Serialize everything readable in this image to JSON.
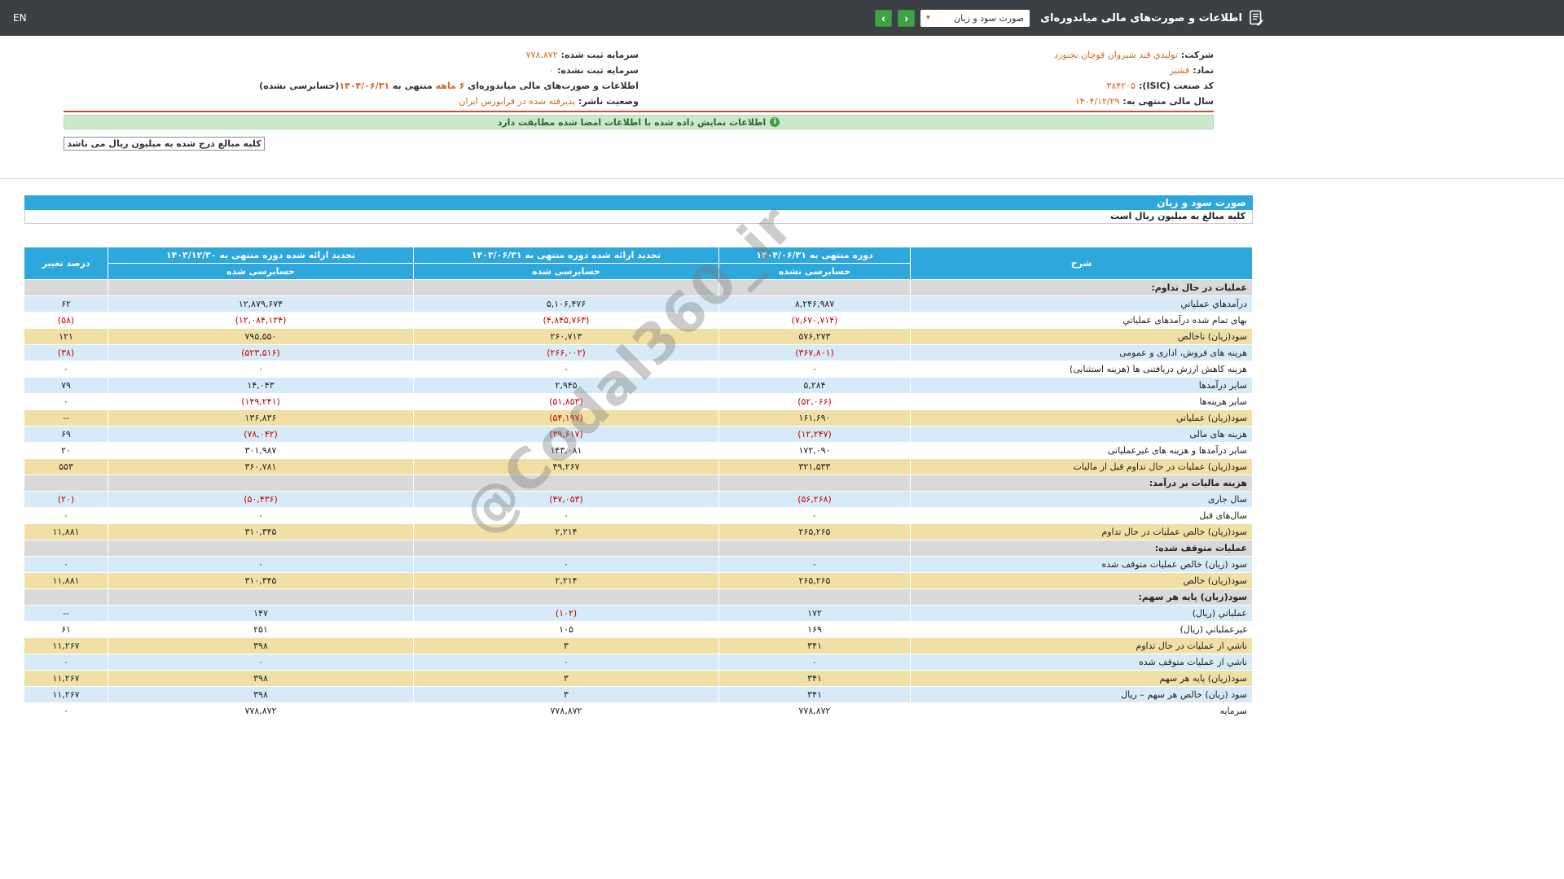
{
  "navbar": {
    "report_title": "اطلاعات و صورت‌های مالی میاندوره‌ای",
    "statement_select": "صورت سود و زیان",
    "caret_glyph": "▾",
    "prev_glyph": "‹",
    "next_glyph": "›",
    "lang": "EN"
  },
  "company": {
    "rows_right": [
      {
        "label": "شرکت:",
        "value": "تولیدي قند شیروان قوچان بجنورد"
      },
      {
        "label": "نماد:",
        "value": "قشیر"
      },
      {
        "label": "کد صنعت (ISIC):",
        "value": "۳۸۴۲۰۵"
      },
      {
        "label": "سال مالی منتهی به:",
        "value": "۱۴۰۴/۱۲/۲۹"
      }
    ],
    "rows_left": [
      {
        "label": "سرمایه ثبت شده:",
        "value": "۷۷۸,۸۷۲"
      },
      {
        "label": "سرمایه ثبت نشده:",
        "value": "۰"
      },
      {
        "parts": [
          {
            "text": "اطلاعات و صورت‌های مالی میاندوره‌ای ",
            "hl": false
          },
          {
            "text": "۶ ماهه",
            "hl": true
          },
          {
            "text": " منتهی به ",
            "hl": false
          },
          {
            "text": "۱۴۰۴/۰۶/۳۱",
            "hl": true
          },
          {
            "text": "(حسابرسی نشده)",
            "hl": false
          }
        ]
      },
      {
        "label": "وضعیت ناشر:",
        "value": "پذیرفته شده در فرابورس ایران"
      }
    ]
  },
  "signed_notice": {
    "icon_glyph": "i",
    "text": "اطلاعات نمایش داده شده با اطلاعات امضا شده مطابقت دارد"
  },
  "unit_note": "کلیه مبالغ درج شده به میلیون ریال می باشد",
  "statement": {
    "title": "صورت سود و زیان",
    "subtitle": "کلیه مبالغ به میلیون ریال است"
  },
  "watermark": "@Codal360_ir",
  "colors": {
    "navbar_bg": "#3b4045",
    "accent_blue": "#2ea7dc",
    "row_blue": "#d6ebf7",
    "row_gold": "#f1e0a6",
    "section_gray": "#d9d9d9",
    "negative_red": "#cc0000",
    "highlight_orange": "#d2691e",
    "button_green": "#43a047",
    "banner_green_bg": "#cce8cc",
    "info_rule_red": "#c05046"
  },
  "table": {
    "headers": {
      "desc": "شرح",
      "cols": [
        {
          "title": "دوره منتهی به ۱۴۰۴/۰۶/۳۱",
          "sub": "حسابرسی نشده"
        },
        {
          "title": "تجدید ارائه شده دوره منتهی به ۱۴۰۳/۰۶/۳۱",
          "sub": "حسابرسی شده"
        },
        {
          "title": "تجدید ارائه شده دوره منتهی به ۱۴۰۳/۱۲/۳۰",
          "sub": "حسابرسی شده"
        }
      ],
      "change": "درصد تغییر"
    },
    "rows": [
      {
        "t": "section",
        "label": "عملیات در حال تداوم:"
      },
      {
        "t": "row",
        "v": "blue",
        "label": "درآمدهاي عملیاتي",
        "c": [
          "۸,۲۴۶,۹۸۷",
          "۵,۱۰۶,۴۷۶",
          "۱۲,۸۷۹,۶۷۴",
          "۶۲"
        ]
      },
      {
        "t": "row",
        "v": "white",
        "label": "بهای تمام شده درآمدهای عملیاتي",
        "c": [
          "(۷,۶۷۰,۷۱۴)",
          "(۴,۸۴۵,۷۶۳)",
          "(۱۲,۰۸۴,۱۲۴)",
          "(۵۸)"
        ]
      },
      {
        "t": "row",
        "v": "gold",
        "label": "سود(زیان) ناخالص",
        "c": [
          "۵۷۶,۲۷۳",
          "۲۶۰,۷۱۳",
          "۷۹۵,۵۵۰",
          "۱۲۱"
        ]
      },
      {
        "t": "row",
        "v": "blue",
        "label": "هزینه های فروش، اداری و عمومی",
        "c": [
          "(۳۶۷,۸۰۱)",
          "(۲۶۶,۰۰۲)",
          "(۵۲۳,۵۱۶)",
          "(۳۸)"
        ]
      },
      {
        "t": "row",
        "v": "white",
        "label": "هزینه کاهش ارزش دریافتنی ها (هزینه استثنایی)",
        "c": [
          "۰",
          "۰",
          "۰",
          "۰"
        ]
      },
      {
        "t": "row",
        "v": "blue",
        "label": "سایر درآمدها",
        "c": [
          "۵,۲۸۴",
          "۲,۹۴۵",
          "۱۴,۰۴۳",
          "۷۹"
        ]
      },
      {
        "t": "row",
        "v": "white",
        "label": "سایر هزینه‌ها",
        "c": [
          "(۵۲,۰۶۶)",
          "(۵۱,۸۵۳)",
          "(۱۴۹,۲۴۱)",
          "۰"
        ]
      },
      {
        "t": "row",
        "v": "gold",
        "label": "سود(زیان) عملیاتي",
        "c": [
          "۱۶۱,۶۹۰",
          "(۵۴,۱۹۷)",
          "۱۳۶,۸۳۶",
          "--"
        ]
      },
      {
        "t": "row",
        "v": "blue",
        "label": "هزینه های مالی",
        "c": [
          "(۱۲,۲۴۷)",
          "(۳۹,۶۱۷)",
          "(۷۸,۰۴۲)",
          "۶۹"
        ]
      },
      {
        "t": "row",
        "v": "white",
        "label": "سایر درآمدها و هزینه های غیرعملیاتی",
        "c": [
          "۱۷۲,۰۹۰",
          "۱۴۳,۰۸۱",
          "۳۰۱,۹۸۷",
          "۲۰"
        ]
      },
      {
        "t": "row",
        "v": "gold",
        "label": "سود(زیان) عملیات در حال تداوم قبل از مالیات",
        "c": [
          "۳۲۱,۵۳۳",
          "۴۹,۲۶۷",
          "۳۶۰,۷۸۱",
          "۵۵۳"
        ]
      },
      {
        "t": "section",
        "label": "هزینه مالیات بر درآمد:"
      },
      {
        "t": "row",
        "v": "blue",
        "label": "سال جاری",
        "c": [
          "(۵۶,۲۶۸)",
          "(۴۷,۰۵۳)",
          "(۵۰,۴۳۶)",
          "(۲۰)"
        ]
      },
      {
        "t": "row",
        "v": "white",
        "label": "سال‌های قبل",
        "c": [
          "۰",
          "۰",
          "۰",
          "۰"
        ]
      },
      {
        "t": "row",
        "v": "gold",
        "label": "سود(زیان) خالص عملیات در حال تداوم",
        "c": [
          "۲۶۵,۲۶۵",
          "۲,۲۱۴",
          "۳۱۰,۳۴۵",
          "۱۱,۸۸۱"
        ]
      },
      {
        "t": "section",
        "label": "عملیات متوقف شده:"
      },
      {
        "t": "row",
        "v": "blue",
        "label": "سود (زیان) خالص عملیات متوقف شده",
        "c": [
          "۰",
          "۰",
          "۰",
          "۰"
        ]
      },
      {
        "t": "row",
        "v": "gold",
        "label": "سود(زیان) خالص",
        "c": [
          "۲۶۵,۲۶۵",
          "۲,۲۱۴",
          "۳۱۰,۳۴۵",
          "۱۱,۸۸۱"
        ]
      },
      {
        "t": "section",
        "label": "سود(زیان) پایه هر سهم:"
      },
      {
        "t": "row",
        "v": "blue",
        "label": "عملیاتي (ریال)",
        "c": [
          "۱۷۲",
          "(۱۰۲)",
          "۱۴۷",
          "--"
        ]
      },
      {
        "t": "row",
        "v": "white",
        "label": "غیرعملیاتي (ریال)",
        "c": [
          "۱۶۹",
          "۱۰۵",
          "۲۵۱",
          "۶۱"
        ]
      },
      {
        "t": "row",
        "v": "gold",
        "label": "ناشي از عملیات در حال تداوم",
        "c": [
          "۳۴۱",
          "۳",
          "۳۹۸",
          "۱۱,۲۶۷"
        ]
      },
      {
        "t": "row",
        "v": "blue",
        "label": "ناشي از عملیات متوقف شده",
        "c": [
          "۰",
          "۰",
          "۰",
          "۰"
        ]
      },
      {
        "t": "row",
        "v": "gold",
        "label": "سود(زیان) پایه هر سهم",
        "c": [
          "۳۴۱",
          "۳",
          "۳۹۸",
          "۱۱,۲۶۷"
        ]
      },
      {
        "t": "row",
        "v": "blue",
        "label": "سود (زیان) خالص هر سهم – ریال",
        "c": [
          "۳۴۱",
          "۳",
          "۳۹۸",
          "۱۱,۲۶۷"
        ]
      },
      {
        "t": "row",
        "v": "white",
        "label": "سرمایه",
        "c": [
          "۷۷۸,۸۷۲",
          "۷۷۸,۸۷۲",
          "۷۷۸,۸۷۲",
          "۰"
        ]
      }
    ]
  }
}
